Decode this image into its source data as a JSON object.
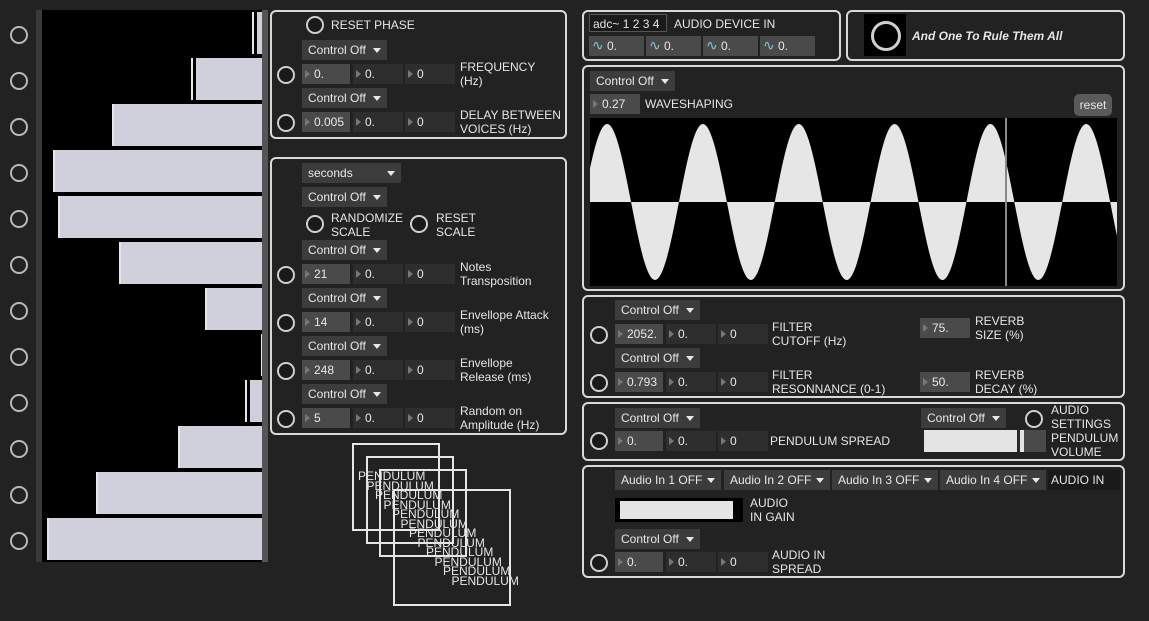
{
  "left_column": {
    "rows": [
      {
        "fill": 0.04,
        "tick": 0.93
      },
      {
        "fill": 0.31,
        "tick": 0.66
      },
      {
        "fill": 0.68,
        "tick": 0.31
      },
      {
        "fill": 0.94,
        "tick": 0.05
      },
      {
        "fill": 0.92,
        "tick": 0.07
      },
      {
        "fill": 0.65,
        "tick": 0.34
      },
      {
        "fill": 0.26,
        "tick": 0.72
      },
      {
        "fill": 0.02,
        "tick": 0.97
      },
      {
        "fill": 0.07,
        "tick": 0.9
      },
      {
        "fill": 0.38,
        "tick": 0.6
      },
      {
        "fill": 0.75,
        "tick": 0.24
      },
      {
        "fill": 0.97,
        "tick": 0.02
      }
    ]
  },
  "phase_panel": {
    "reset_phase": "RESET PHASE",
    "freq_control": "Control Off",
    "freq_values": [
      "0.",
      "0.",
      "0"
    ],
    "freq_label": "FREQUENCY\n(Hz)",
    "delay_control": "Control Off",
    "delay_values": [
      "0.005",
      "0.",
      "0"
    ],
    "delay_label": "DELAY BETWEEN\nVOICES (Hz)"
  },
  "notes_panel": {
    "unit_select": "seconds",
    "scale_control": "Control Off",
    "randomize_scale": "RANDOMIZE\nSCALE",
    "reset_scale": "RESET\nSCALE",
    "params": [
      {
        "control": "Control Off",
        "values": [
          "21",
          "0.",
          "0"
        ],
        "label": "Notes\nTransposition"
      },
      {
        "control": "Control Off",
        "values": [
          "14",
          "0.",
          "0"
        ],
        "label": "Envellope Attack\n(ms)"
      },
      {
        "control": "Control Off",
        "values": [
          "248",
          "0.",
          "0"
        ],
        "label": "Envellope\nRelease (ms)"
      },
      {
        "control": "Control Off",
        "values": [
          "5",
          "0.",
          "0"
        ],
        "label": "Random on\nAmplitude (Hz)"
      }
    ]
  },
  "pendulums": {
    "label": "PENDULUM"
  },
  "audio_in_panel": {
    "adc": "adc~ 1 2 3 4",
    "label": "AUDIO DEVICE IN",
    "meters": [
      "0.",
      "0.",
      "0.",
      "0."
    ]
  },
  "master": {
    "label": "And One To Rule Them All"
  },
  "waveshaping": {
    "control": "Control Off",
    "value": "0.27",
    "label": "WAVESHAPING",
    "reset": "reset",
    "cycles": 5.5
  },
  "filter_panel": {
    "cutoff_control": "Control Off",
    "cutoff_values": [
      "2052.",
      "0.",
      "0"
    ],
    "cutoff_label": "FILTER\nCUTOFF (Hz)",
    "res_control": "Control Off",
    "res_values": [
      "0.793",
      "0.",
      "0"
    ],
    "res_label": "FILTER\nRESONNANCE (0-1)",
    "reverb_size": "75.",
    "reverb_size_label": "REVERB\nSIZE (%)",
    "reverb_decay": "50.",
    "reverb_decay_label": "REVERB\nDECAY (%)"
  },
  "spread_panel": {
    "control": "Control Off",
    "values": [
      "0.",
      "0.",
      "0"
    ],
    "label": "PENDULUM SPREAD",
    "vol_control": "Control Off",
    "audio_settings": "AUDIO\nSETTINGS",
    "volume_label": "PENDULUM\nVOLUME",
    "volume": 0.82
  },
  "audio_gain_panel": {
    "inputs": [
      "Audio In 1 OFF",
      "Audio In 2 OFF",
      "Audio In 3 OFF",
      "Audio In 4 OFF"
    ],
    "audio_in": "AUDIO IN",
    "gain_label": "AUDIO\nIN GAIN",
    "gain": 0.95,
    "spread_control": "Control Off",
    "spread_values": [
      "0.",
      "0.",
      "0"
    ],
    "spread_label": "AUDIO IN\nSPREAD"
  },
  "colors": {
    "accent": "#cfd0dc",
    "panel_border": "#d8d8d8",
    "background": "#222222"
  }
}
